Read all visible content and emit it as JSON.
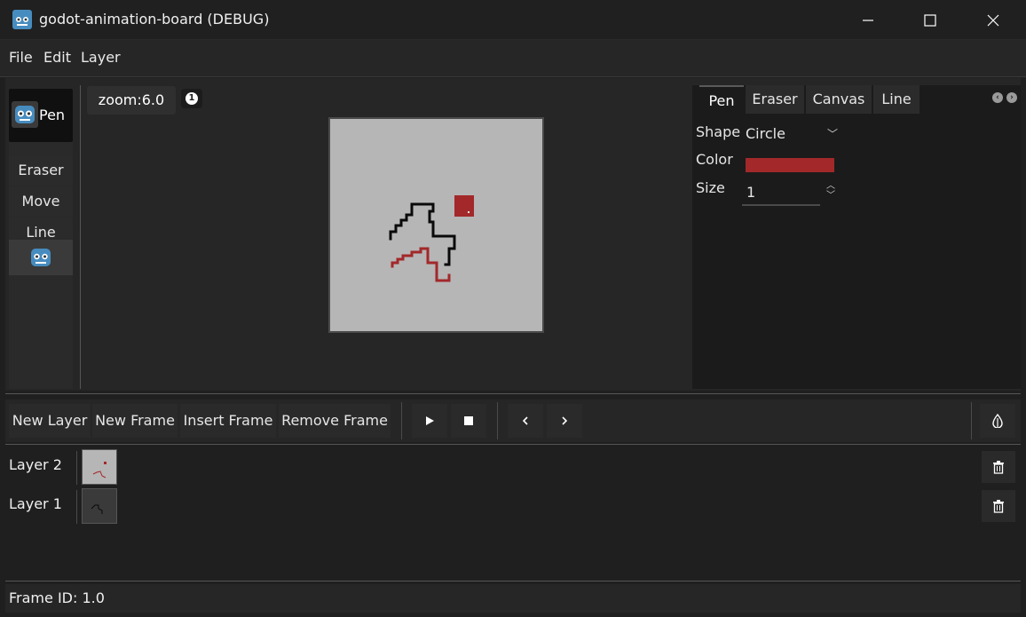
{
  "window": {
    "title": "godot-animation-board (DEBUG)",
    "minimize": "—",
    "maximize": "☐",
    "close": "✕"
  },
  "menu": {
    "items": [
      "File",
      "Edit",
      "Layer"
    ]
  },
  "tools": {
    "pen": "Pen",
    "eraser": "Eraser",
    "move": "Move",
    "line": "Line"
  },
  "canvas": {
    "zoom": "zoom:6.0",
    "info_badge": "1"
  },
  "properties": {
    "tabs": [
      "Pen",
      "Eraser",
      "Canvas",
      "Line"
    ],
    "active_tab": "Pen",
    "shape_label": "Shape",
    "shape_value": "Circle",
    "color_label": "Color",
    "color_value": "#a3282a",
    "size_label": "Size",
    "size_value": "1"
  },
  "timeline": {
    "new_layer": "New Layer",
    "new_frame": "New Frame",
    "insert_frame": "Insert Frame",
    "remove_frame": "Remove Frame"
  },
  "layers": [
    {
      "name": "Layer 2"
    },
    {
      "name": "Layer 1"
    }
  ],
  "status": {
    "frame_id": "Frame ID: 1.0"
  },
  "colors": {
    "background": "#1f1f1f",
    "panel": "#262626",
    "canvas": "#b6b6b6",
    "pen_red": "#a3282a",
    "stroke_black": "#0a0a0a"
  }
}
